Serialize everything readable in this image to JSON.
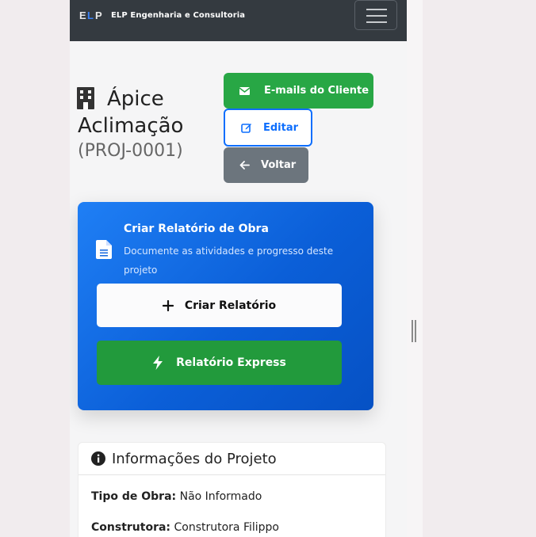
{
  "navbar": {
    "brand_text": "ELP Engenharia e Consultoria",
    "logo_text": "ELP"
  },
  "project": {
    "title_line1": "Ápice",
    "title_line2": "Aclimação",
    "code": "(PROJ-0001)"
  },
  "actions": {
    "emails_label": "E-mails do Cliente",
    "edit_label": "Editar",
    "back_label": "Voltar"
  },
  "report_card": {
    "title": "Criar Relatório de Obra",
    "description": "Documente as atividades e progresso deste projeto",
    "create_label": "Criar Relatório",
    "express_label": "Relatório Express"
  },
  "info": {
    "title": "Informações do Projeto",
    "rows": [
      {
        "label": "Tipo de Obra:",
        "value": "Não Informado"
      },
      {
        "label": "Construtora:",
        "value": "Construtora Filippo"
      }
    ]
  },
  "colors": {
    "navbar": "#343a40",
    "success": "#28a745",
    "primary": "#0d6efd",
    "secondary": "#6c757d"
  }
}
